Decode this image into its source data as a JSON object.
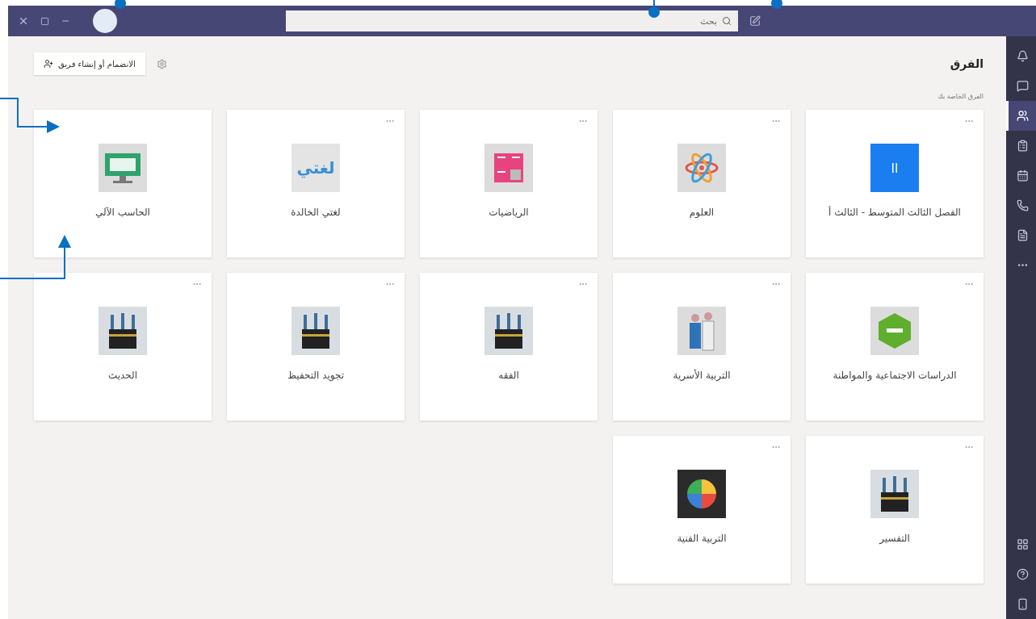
{
  "search": {
    "placeholder": "بحث"
  },
  "header": {
    "title": "الفرق",
    "join_button": "الانضمام أو إنشاء فريق"
  },
  "section_label": "الفرق الخاصة بك",
  "rail": [
    {
      "kind": "bell",
      "selected": false
    },
    {
      "kind": "chat",
      "selected": false
    },
    {
      "kind": "teams",
      "selected": true
    },
    {
      "kind": "assignments",
      "selected": false
    },
    {
      "kind": "calendar",
      "selected": false
    },
    {
      "kind": "calls",
      "selected": false
    },
    {
      "kind": "files",
      "selected": false
    },
    {
      "kind": "more",
      "selected": false
    }
  ],
  "rail_bottom": [
    {
      "kind": "apps",
      "selected": false
    },
    {
      "kind": "help",
      "selected": false
    },
    {
      "kind": "device",
      "selected": false
    }
  ],
  "teams": [
    {
      "name": "الفصل الثالث المتوسط - الثالث أ",
      "kind": "tile",
      "tile_text": "ll",
      "more": true
    },
    {
      "name": "العلوم",
      "kind": "atom",
      "more": true
    },
    {
      "name": "الرياضيات",
      "kind": "calc",
      "more": true
    },
    {
      "name": "لغتي الخالدة",
      "kind": "logo",
      "logo_text": "لغتي",
      "more": true
    },
    {
      "name": "الحاسب الآلي",
      "kind": "computer",
      "more": false
    },
    {
      "name": "الدراسات الاجتماعية والمواطنة",
      "kind": "hexagon",
      "more": true
    },
    {
      "name": "التربية الأسرية",
      "kind": "family",
      "more": true
    },
    {
      "name": "الفقه",
      "kind": "kaaba",
      "more": true
    },
    {
      "name": "تجويد التحفيظ",
      "kind": "kaaba",
      "more": true
    },
    {
      "name": "الحديث",
      "kind": "kaaba",
      "more": true
    },
    {
      "name": "التفسير",
      "kind": "kaaba",
      "more": true
    },
    {
      "name": "التربية الفنية",
      "kind": "palette",
      "more": true
    }
  ]
}
